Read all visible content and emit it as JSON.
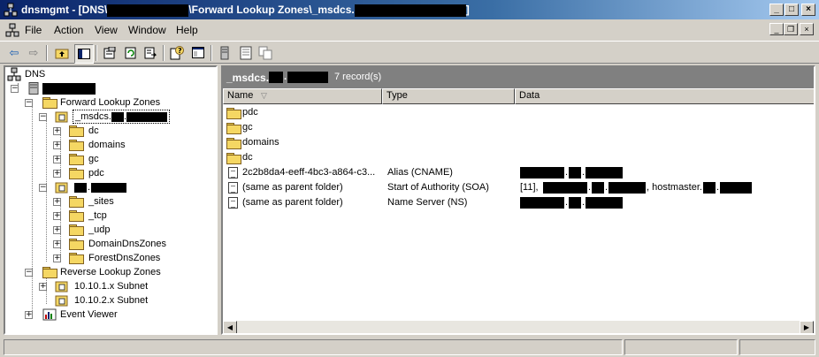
{
  "window": {
    "title_prefix": "dnsmgmt - [DNS\\",
    "title_mid": "\\Forward Lookup Zones\\_msdcs.",
    "title_suffix": "]",
    "minimize": "_",
    "maximize": "□",
    "close": "×"
  },
  "menu": {
    "file": "File",
    "action": "Action",
    "view": "View",
    "window": "Window",
    "help": "Help"
  },
  "toolbar": {
    "icons": [
      "back-arrow-icon",
      "forward-arrow-icon",
      "up-folder-icon",
      "show-tree-icon",
      "properties-icon",
      "refresh-icon",
      "export-icon",
      "help-icon",
      "console-icon",
      "server-icon",
      "zone-icon",
      "copy-icon"
    ]
  },
  "tree": {
    "root": "DNS",
    "forward": "Forward Lookup Zones",
    "msdcs": "_msdcs.",
    "msdcs_children": [
      "dc",
      "domains",
      "gc",
      "pdc"
    ],
    "domain_children": [
      "_sites",
      "_tcp",
      "_udp",
      "DomainDnsZones",
      "ForestDnsZones"
    ],
    "reverse": "Reverse Lookup Zones",
    "reverse_children": [
      "10.10.1.x Subnet",
      "10.10.2.x Subnet"
    ],
    "event_viewer": "Event Viewer"
  },
  "right": {
    "header_prefix": "_msdcs.",
    "record_count": "7 record(s)",
    "columns": {
      "name": "Name",
      "type": "Type",
      "data": "Data"
    },
    "folders": [
      "pdc",
      "gc",
      "domains",
      "dc"
    ],
    "records": [
      {
        "name": "2c2b8da4-eeff-4bc3-a864-c3...",
        "type": "Alias (CNAME)"
      },
      {
        "name": "(same as parent folder)",
        "type": "Start of Authority (SOA)",
        "data_prefix": "[11],",
        "data_mid": ", hostmaster."
      },
      {
        "name": "(same as parent folder)",
        "type": "Name Server (NS)"
      }
    ]
  }
}
